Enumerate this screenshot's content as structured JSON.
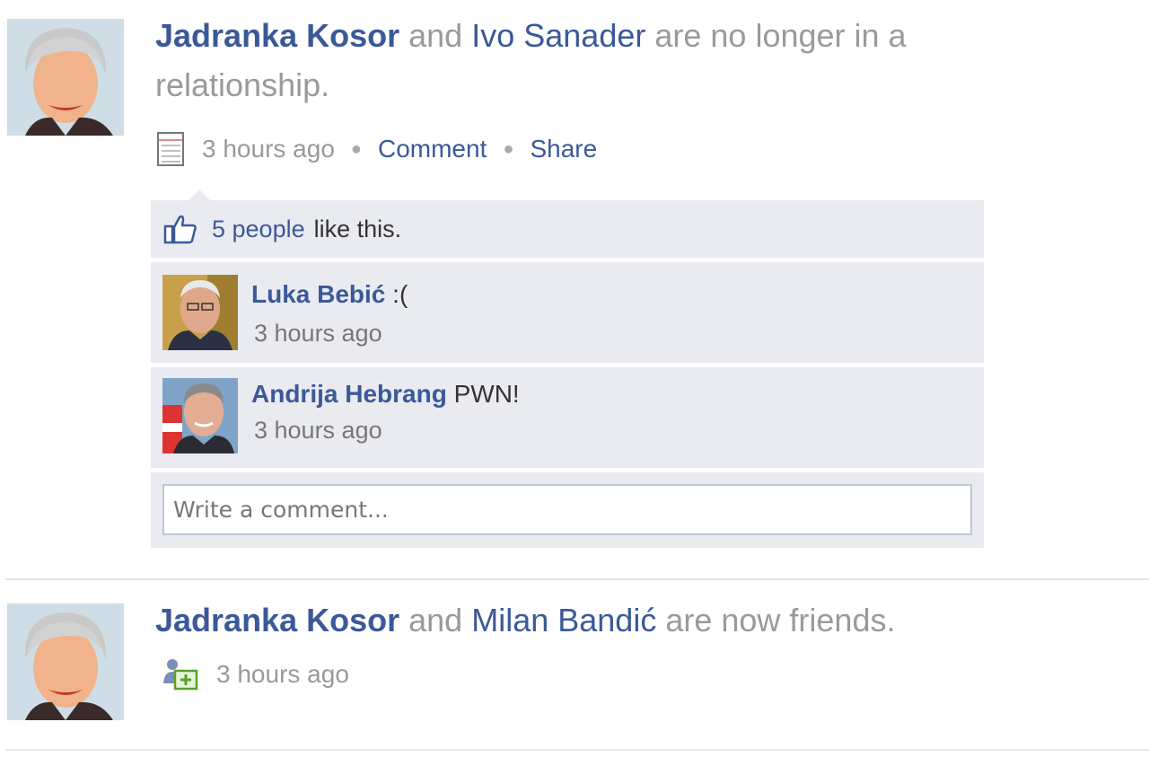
{
  "stories": [
    {
      "actor": "Jadranka Kosor",
      "connector": "and",
      "target": "Ivo Sanader",
      "rest": "are no longer in a relationship.",
      "time": "3 hours ago",
      "actions": {
        "comment": "Comment",
        "share": "Share"
      },
      "icon": "note-icon",
      "likes": {
        "count_text": "5 people",
        "suffix": "like this."
      },
      "comments": [
        {
          "name": "Luka Bebić",
          "text": ":(",
          "time": "3 hours ago"
        },
        {
          "name": "Andrija Hebrang",
          "text": "PWN!",
          "time": "3 hours ago"
        }
      ],
      "comment_placeholder": "Write a comment..."
    },
    {
      "actor": "Jadranka Kosor",
      "connector": "and",
      "target": "Milan Bandić",
      "rest": "are now friends.",
      "time": "3 hours ago",
      "icon": "friends-icon"
    }
  ],
  "colors": {
    "link": "#3b5998",
    "feedback_bg": "#e9ebf1",
    "muted": "#9a9a9a"
  }
}
